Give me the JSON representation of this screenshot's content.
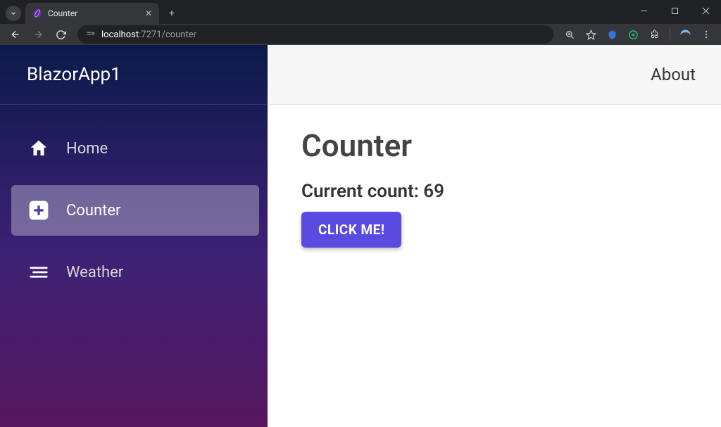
{
  "browser": {
    "tab_title": "Counter",
    "url_host": "localhost",
    "url_port_path": ":7271/counter"
  },
  "sidebar": {
    "brand": "BlazorApp1",
    "items": [
      {
        "label": "Home",
        "icon": "home-icon",
        "active": false
      },
      {
        "label": "Counter",
        "icon": "plus-icon",
        "active": true
      },
      {
        "label": "Weather",
        "icon": "list-icon",
        "active": false
      }
    ]
  },
  "topbar": {
    "about_label": "About"
  },
  "main": {
    "heading": "Counter",
    "count_label": "Current count: ",
    "count_value": "69",
    "button_label": "CLICK ME!"
  }
}
